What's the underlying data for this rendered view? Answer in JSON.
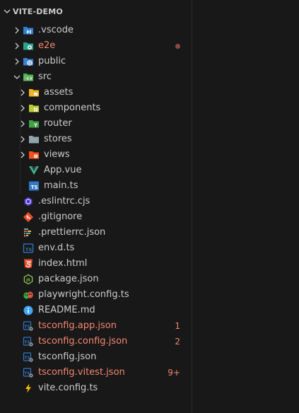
{
  "explorer": {
    "title": "VITE-DEMO",
    "items": [
      {
        "label": "vscode",
        "prefix": ".",
        "kind": "folder",
        "state": "collapsed",
        "depth": 0,
        "icon": "vscode-folder-icon"
      },
      {
        "label": "e2e",
        "kind": "folder",
        "state": "collapsed",
        "depth": 0,
        "icon": "e2e-folder-icon",
        "status": "error-dot"
      },
      {
        "label": "public",
        "kind": "folder",
        "state": "collapsed",
        "depth": 0,
        "icon": "public-folder-icon"
      },
      {
        "label": "src",
        "kind": "folder",
        "state": "expanded",
        "depth": 0,
        "icon": "src-folder-icon"
      },
      {
        "label": "assets",
        "kind": "folder",
        "state": "collapsed",
        "depth": 1,
        "icon": "assets-folder-icon"
      },
      {
        "label": "components",
        "kind": "folder",
        "state": "collapsed",
        "depth": 1,
        "icon": "components-folder-icon"
      },
      {
        "label": "router",
        "kind": "folder",
        "state": "collapsed",
        "depth": 1,
        "icon": "router-folder-icon"
      },
      {
        "label": "stores",
        "kind": "folder",
        "state": "collapsed",
        "depth": 1,
        "icon": "stores-folder-icon"
      },
      {
        "label": "views",
        "kind": "folder",
        "state": "collapsed",
        "depth": 1,
        "icon": "views-folder-icon"
      },
      {
        "label": "App.vue",
        "kind": "file",
        "depth": 1,
        "icon": "vue-file-icon"
      },
      {
        "label": "main.ts",
        "kind": "file",
        "depth": 1,
        "icon": "typescript-file-icon"
      },
      {
        "label": ".eslintrc.cjs",
        "kind": "file",
        "depth": 0,
        "icon": "eslint-file-icon"
      },
      {
        "label": ".gitignore",
        "kind": "file",
        "depth": 0,
        "icon": "git-file-icon"
      },
      {
        "label": ".prettierrc.json",
        "kind": "file",
        "depth": 0,
        "icon": "prettier-file-icon"
      },
      {
        "label": "env.d.ts",
        "kind": "file",
        "depth": 0,
        "icon": "typescript-def-file-icon"
      },
      {
        "label": "index.html",
        "kind": "file",
        "depth": 0,
        "icon": "html-file-icon"
      },
      {
        "label": "package.json",
        "kind": "file",
        "depth": 0,
        "icon": "nodejs-file-icon"
      },
      {
        "label": "playwright.config.ts",
        "kind": "file",
        "depth": 0,
        "icon": "playwright-file-icon"
      },
      {
        "label": "README.md",
        "kind": "file",
        "depth": 0,
        "icon": "info-file-icon"
      },
      {
        "label": "tsconfig.app.json",
        "kind": "file",
        "depth": 0,
        "icon": "tsconfig-file-icon",
        "status": "error",
        "badge": "1"
      },
      {
        "label": "tsconfig.config.json",
        "kind": "file",
        "depth": 0,
        "icon": "tsconfig-file-icon",
        "status": "error",
        "badge": "2"
      },
      {
        "label": "tsconfig.json",
        "kind": "file",
        "depth": 0,
        "icon": "tsconfig-file-icon"
      },
      {
        "label": "tsconfig.vitest.json",
        "kind": "file",
        "depth": 0,
        "icon": "tsconfig-file-icon",
        "status": "error",
        "badge": "9+"
      },
      {
        "label": "vite.config.ts",
        "kind": "file",
        "depth": 0,
        "icon": "vite-file-icon"
      }
    ]
  },
  "colors": {
    "background": "#181818",
    "text": "#cccccc",
    "error": "#f48771",
    "modified_dot": "#8a4a44"
  }
}
